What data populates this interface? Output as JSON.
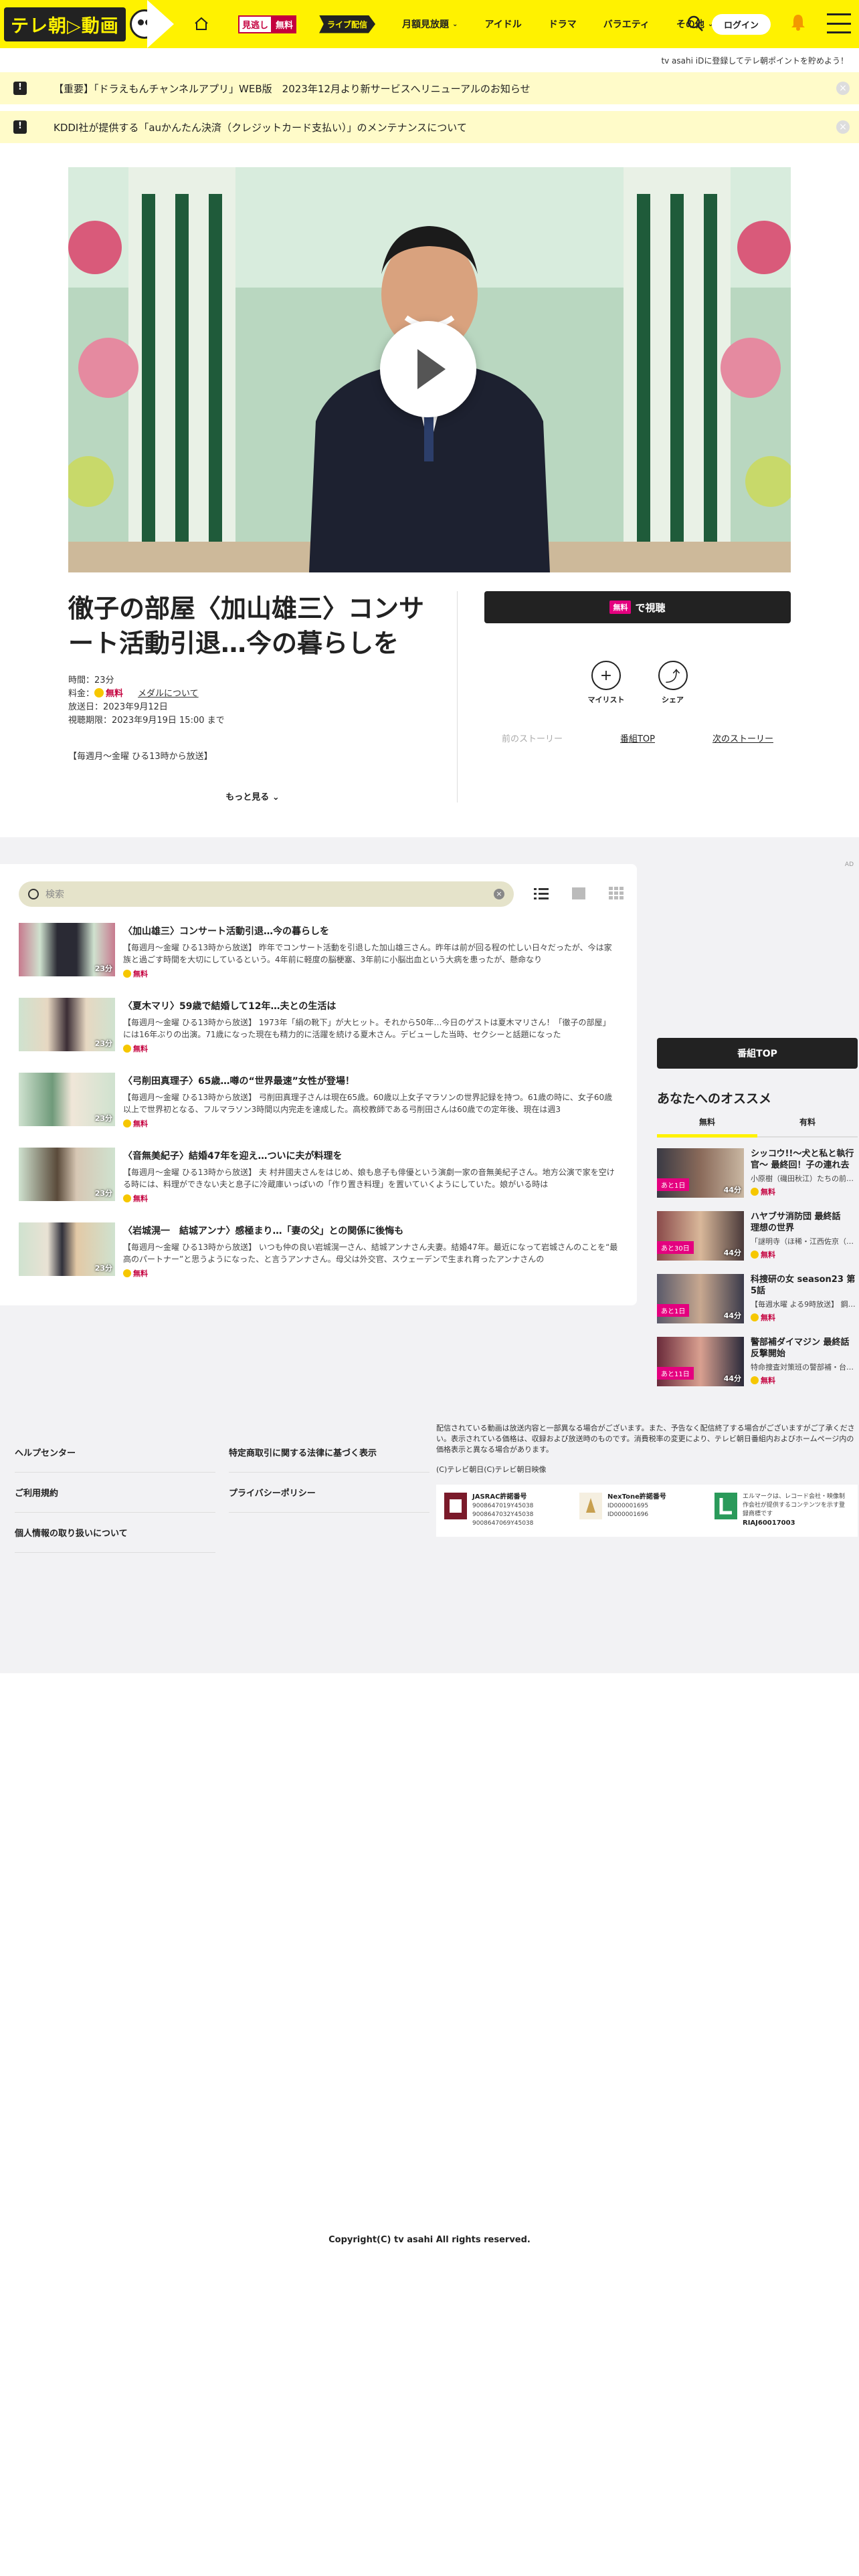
{
  "header": {
    "logo_text": "テレ朝▷動画",
    "free_badge_left": "見逃し",
    "free_badge_right": "無料",
    "live_badge": "ライブ配信",
    "nav": [
      "月額見放題",
      "アイドル",
      "ドラマ",
      "バラエティ",
      "その他"
    ],
    "login": "ログイン",
    "promo": "tv asahi iDに登録してテレ朝ポイントを貯めよう！"
  },
  "notices": [
    "【重要】「ドラえもんチャンネルアプリ」WEB版　2023年12月より新サービスへリニューアルのお知らせ",
    "KDDI社が提供する「auかんたん決済（クレジットカード支払い）」のメンテナンスについて"
  ],
  "program": {
    "title": "徹子の部屋〈加山雄三〉コンサート活動引退…今の暮らしを",
    "duration": "時間：23分",
    "price_label": "料金：",
    "price": "無料",
    "medal": "メダルについて",
    "aired": "放送日：2023年9月12日",
    "deadline": "視聴期限：2023年9月19日 15:00 まで",
    "slot": "【毎週月〜金曜 ひる13時から放送】",
    "more": "もっと見る",
    "watch_badge": "無料",
    "watch": "で視聴",
    "mylist": "マイリスト",
    "share": "シェア",
    "prev": "前のストーリー",
    "top": "番組TOP",
    "next": "次のストーリー"
  },
  "list": {
    "search_placeholder": "検索",
    "episodes": [
      {
        "title": "〈加山雄三〉コンサート活動引退…今の暮らしを",
        "desc": "【毎週月〜金曜 ひる13時から放送】 昨年でコンサート活動を引退した加山雄三さん。昨年は前が回る程の忙しい日々だったが、今は家族と過ごす時間を大切にしているという。4年前に軽度の脳梗塞、3年前に小脳出血という大病を患ったが、懸命なり",
        "time": "23分",
        "free": "無料"
      },
      {
        "title": "〈夏木マリ〉59歳で結婚して12年…夫との生活は",
        "desc": "【毎週月〜金曜 ひる13時から放送】 1973年「絹の靴下」が大ヒット。それから50年…今日のゲストは夏木マリさん！「徹子の部屋」には16年ぶりの出演。71歳になった現在も精力的に活躍を続ける夏木さん。デビューした当時、セクシーと話題になった",
        "time": "23分",
        "free": "無料"
      },
      {
        "title": "〈弓削田真理子〉65歳…噂の“世界最速”女性が登場！",
        "desc": "【毎週月〜金曜 ひる13時から放送】 弓削田真理子さんは現在65歳。60歳以上女子マラソンの世界記録を持つ。61歳の時に、女子60歳以上で世界初となる、フルマラソン3時間以内完走を達成した。高校教師である弓削田さんは60歳での定年後、現在は週3",
        "time": "23分",
        "free": "無料"
      },
      {
        "title": "〈音無美紀子〉結婚47年を迎え…ついに夫が料理を",
        "desc": "【毎週月〜金曜 ひる13時から放送】 夫 村井國夫さんをはじめ、娘も息子も俳優という演劇一家の音無美紀子さん。地方公演で家を空ける時には、料理ができない夫と息子に冷蔵庫いっぱいの「作り置き料理」を置いていくようにしていた。娘がいる時は",
        "time": "23分",
        "free": "無料"
      },
      {
        "title": "〈岩城滉一　結城アンナ〉感極まり…「妻の父」との関係に後悔も",
        "desc": "【毎週月〜金曜 ひる13時から放送】 いつも仲の良い岩城滉一さん、結城アンナさん夫妻。結婚47年。最近になって岩城さんのことを“最高のパートナー”と思うようになった、と言うアンナさん。母父は外交官、スウェーデンで生まれ育ったアンナさんの",
        "time": "23分",
        "free": "無料"
      }
    ]
  },
  "side": {
    "top_button": "番組TOP",
    "heading": "あなたへのオススメ",
    "tabs": [
      "無料",
      "有料"
    ],
    "items": [
      {
        "title": "シッコウ!!～犬と私と執行官～ 最終回！子の連れ去り…",
        "desc": "小原樹（磯田秋江）たちの前…",
        "label": "あと1日",
        "time": "44分",
        "free": "無料"
      },
      {
        "title": "ハヤブサ消防団 最終話　理想の世界",
        "desc": "「謎明寺（ほ稀・江西佐京（遠…",
        "label": "あと30日",
        "time": "44分",
        "free": "無料"
      },
      {
        "title": "科捜研の女 season23 第5話",
        "desc": "【毎週水曜 よる9時放送】 鋼…",
        "label": "あと1日",
        "time": "44分",
        "free": "無料"
      },
      {
        "title": "警部補ダイマジン 最終話　反撃開始",
        "desc": "特命捜査対策班の警部補・台…",
        "label": "あと11日",
        "time": "44分",
        "free": "無料"
      }
    ]
  },
  "footer": {
    "links_left": [
      "ヘルプセンター",
      "ご利用規約",
      "個人情報の取り扱いについて"
    ],
    "links_mid": [
      "特定商取引に関する法律に基づく表示",
      "プライバシーポリシー"
    ],
    "disclaimer": "配信されている動画は放送内容と一部異なる場合がございます。また、予告なく配信終了する場合がございますがご了承ください。表示されている価格は、収録および放送時のものです。消費税率の変更により、テレビ朝日番組内およびホームページ内の価格表示と異なる場合があります。",
    "copy_small": "(C)テレビ朝日(C)テレビ朝日映像",
    "lic1_title": "JASRAC許諾番号",
    "lic1_body": "9008647019Y45038\n9008647032Y45038\n9008647069Y45038",
    "lic2_title": "NexTone許諾番号",
    "lic2_body": "ID000001695\nID000001696",
    "lic3_text": "エルマークは、レコード会社・映像制作会社が提供するコンテンツを示す登録商標です",
    "lic3_id": "RIAJ60017003",
    "copyright": "Copyright(C) tv asahi All rights reserved."
  }
}
